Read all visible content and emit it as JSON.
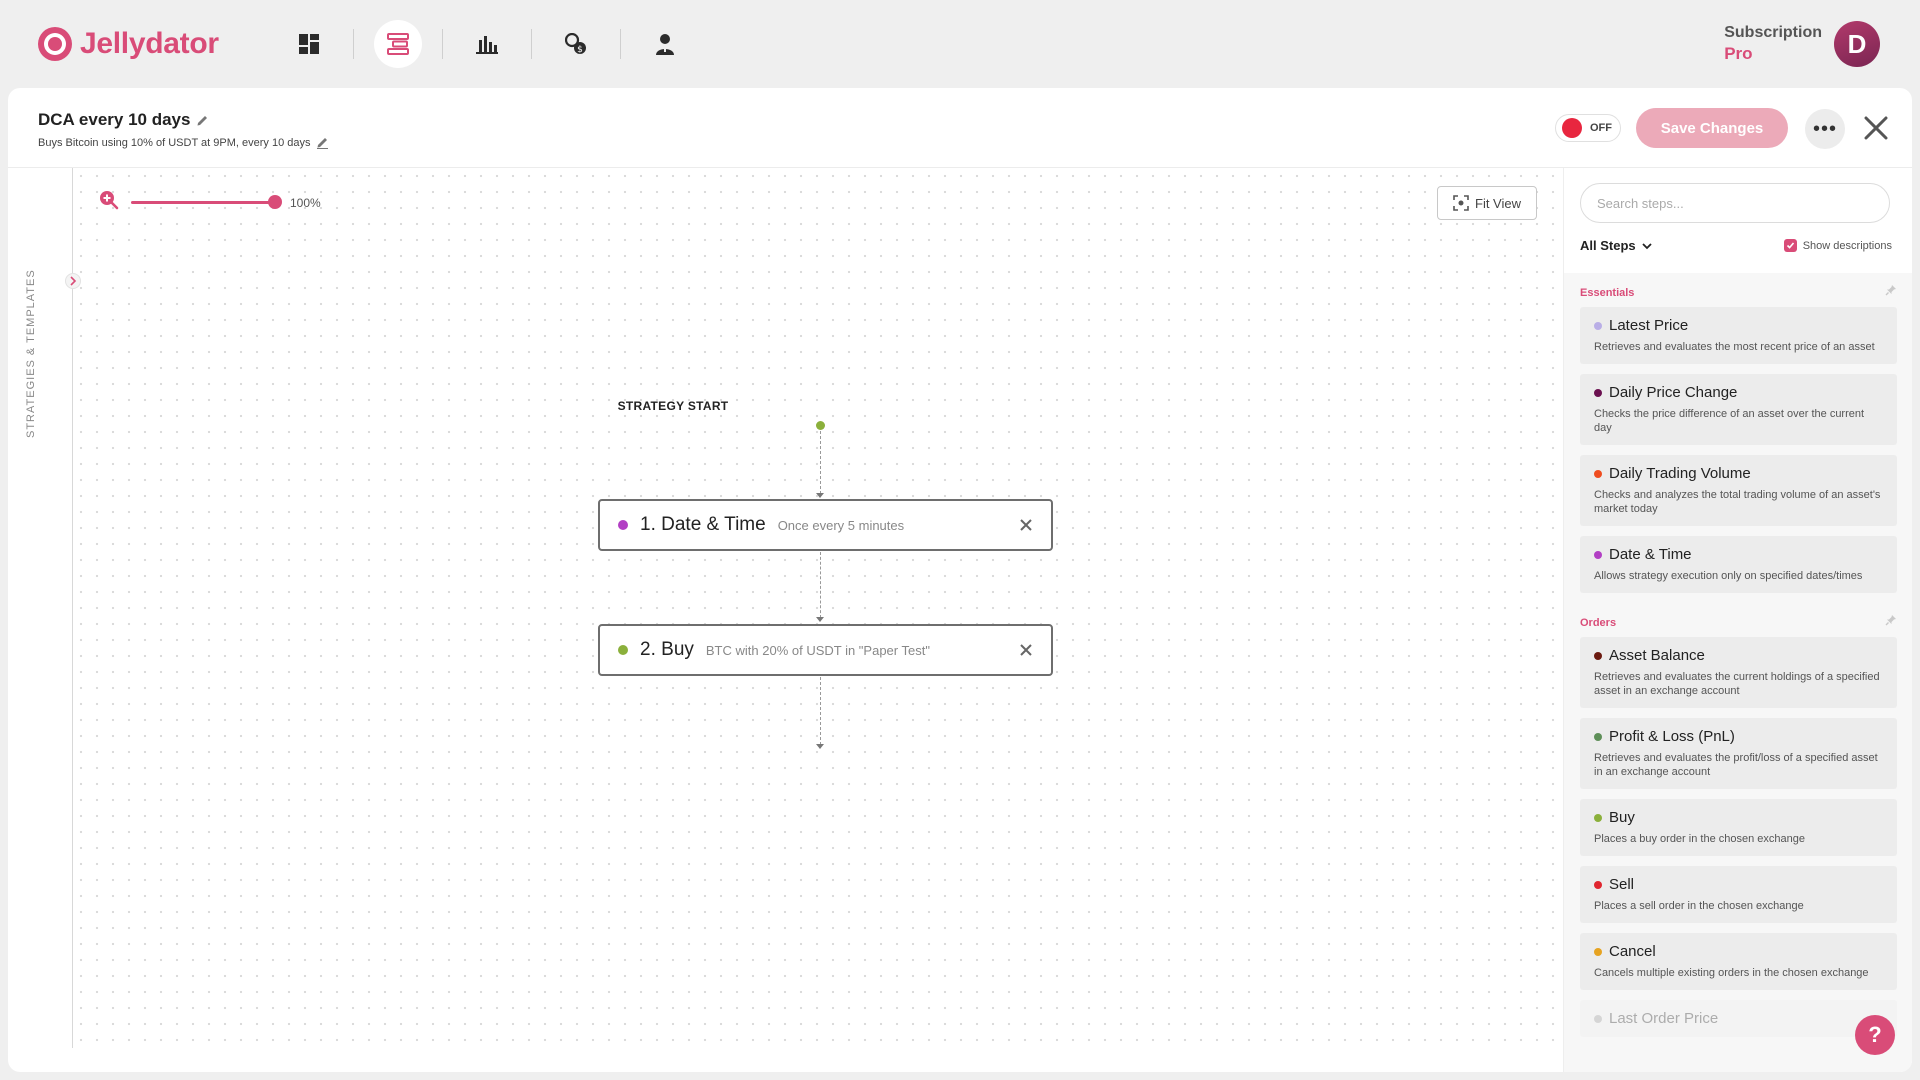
{
  "app": {
    "name": "Jellydator"
  },
  "nav": [
    {
      "icon": "dashboard-icon",
      "active": false
    },
    {
      "icon": "strategies-icon",
      "active": true
    },
    {
      "icon": "chart-icon",
      "active": false
    },
    {
      "icon": "exchange-icon",
      "active": false
    },
    {
      "icon": "user-icon",
      "active": false
    }
  ],
  "account": {
    "subscription_label": "Subscription",
    "plan": "Pro",
    "avatar_letter": "D"
  },
  "strategy": {
    "title": "DCA every 10 days",
    "description": "Buys Bitcoin using 10% of USDT at 9PM, every 10 days",
    "toggle_state": "OFF",
    "save_label": "Save Changes",
    "more_label": "•••"
  },
  "sidebar": {
    "tab_label": "STRATEGIES & TEMPLATES"
  },
  "canvas": {
    "zoom": "100%",
    "zoom_fraction": 1.0,
    "fit_view_label": "Fit View",
    "start_label": "STRATEGY START",
    "nodes": [
      {
        "number": "1.",
        "name": "Date & Time",
        "desc": "Once every 5 minutes",
        "color": "#b23fc4"
      },
      {
        "number": "2.",
        "name": "Buy",
        "desc": "BTC with 20% of USDT in \"Paper Test\"",
        "color": "#8bb03b"
      }
    ]
  },
  "panel": {
    "search_placeholder": "Search steps...",
    "filter_label": "All Steps",
    "show_descriptions_label": "Show descriptions",
    "show_descriptions_checked": true,
    "sections": [
      {
        "title": "Essentials",
        "steps": [
          {
            "name": "Latest Price",
            "desc": "Retrieves and evaluates the most recent price of an asset",
            "color": "#b9aee6"
          },
          {
            "name": "Daily Price Change",
            "desc": "Checks the price difference of an asset over the current day",
            "color": "#6b1150"
          },
          {
            "name": "Daily Trading Volume",
            "desc": "Checks and analyzes the total trading volume of an asset's market today",
            "color": "#ef4d1f"
          },
          {
            "name": "Date & Time",
            "desc": "Allows strategy execution only on specified dates/times",
            "color": "#b23fc4"
          }
        ]
      },
      {
        "title": "Orders",
        "steps": [
          {
            "name": "Asset Balance",
            "desc": "Retrieves and evaluates the current holdings of a specified asset in an exchange account",
            "color": "#6b1a10"
          },
          {
            "name": "Profit & Loss (PnL)",
            "desc": "Retrieves and evaluates the profit/loss of a specified asset in an exchange account",
            "color": "#5e8f58"
          },
          {
            "name": "Buy",
            "desc": "Places a buy order in the chosen exchange",
            "color": "#8bb03b"
          },
          {
            "name": "Sell",
            "desc": "Places a sell order in the chosen exchange",
            "color": "#e0262f"
          },
          {
            "name": "Cancel",
            "desc": "Cancels multiple existing orders in the chosen exchange",
            "color": "#e6a321"
          },
          {
            "name": "Last Order Price",
            "desc": "",
            "color": "#999999"
          }
        ]
      }
    ]
  },
  "help": {
    "label": "?"
  }
}
